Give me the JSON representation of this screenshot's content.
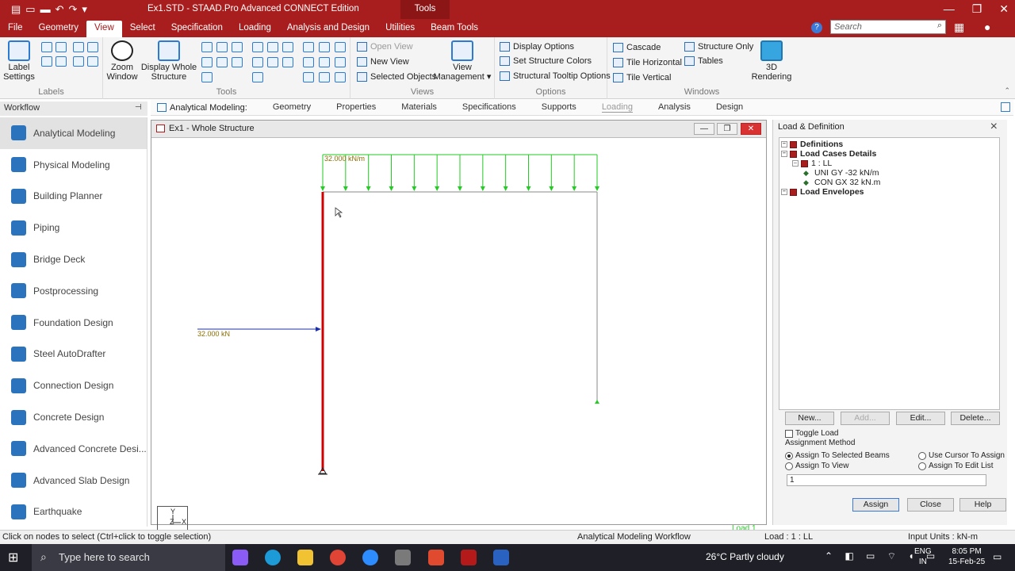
{
  "window": {
    "title": "Ex1.STD - STAAD.Pro Advanced CONNECT Edition",
    "contextual_tab_group": "Tools"
  },
  "menu_tabs": [
    "File",
    "Geometry",
    "View",
    "Select",
    "Specification",
    "Loading",
    "Analysis and Design",
    "Utilities",
    "Beam Tools"
  ],
  "active_menu_tab": "View",
  "search": {
    "placeholder": "Search"
  },
  "ribbon": {
    "labels_group": {
      "name": "Labels",
      "label_settings": "Label Settings"
    },
    "tools_group": {
      "name": "Tools",
      "zoom_window": "Zoom Window",
      "display_whole_structure": "Display Whole Structure"
    },
    "views_group": {
      "name": "Views",
      "open_view": "Open View",
      "new_view": "New View",
      "selected_objects": "Selected Objects",
      "view_management": "View Management"
    },
    "options_group": {
      "name": "Options",
      "display_options": "Display Options",
      "set_structure_colors": "Set Structure Colors",
      "structural_tooltip_options": "Structural Tooltip Options"
    },
    "windows_group": {
      "name": "Windows",
      "cascade": "Cascade",
      "tile_horizontal": "Tile Horizontal",
      "tile_vertical": "Tile Vertical",
      "structure_only": "Structure Only",
      "tables": "Tables",
      "rendering_3d": "3D Rendering"
    }
  },
  "workflow": {
    "title": "Workflow",
    "items": [
      {
        "label": "Analytical Modeling",
        "active": true
      },
      {
        "label": "Physical Modeling"
      },
      {
        "label": "Building Planner"
      },
      {
        "label": "Piping"
      },
      {
        "label": "Bridge Deck"
      },
      {
        "label": "Postprocessing"
      },
      {
        "label": "Foundation Design"
      },
      {
        "label": "Steel AutoDrafter"
      },
      {
        "label": "Connection Design"
      },
      {
        "label": "Concrete Design"
      },
      {
        "label": "Advanced Concrete Desi..."
      },
      {
        "label": "Advanced Slab Design"
      },
      {
        "label": "Earthquake"
      }
    ]
  },
  "subtabs": {
    "lead": "Analytical Modeling:",
    "items": [
      "Geometry",
      "Properties",
      "Materials",
      "Specifications",
      "Supports",
      "Loading",
      "Analysis",
      "Design"
    ],
    "active": "Loading"
  },
  "view_window": {
    "title": "Ex1 - Whole Structure",
    "udl_label": "32.000 kN/m",
    "point_load_label": "32.000 kN",
    "load_indicator": "Load 1",
    "axis": {
      "y": "Y",
      "z": "Z",
      "x": "X"
    }
  },
  "load_definition": {
    "title": "Load & Definition",
    "tree": [
      {
        "label": "Definitions",
        "level": 0,
        "bold": true
      },
      {
        "label": "Load Cases Details",
        "level": 0,
        "bold": true
      },
      {
        "label": "1 : LL",
        "level": 1
      },
      {
        "label": "UNI GY -32 kN/m",
        "level": 2
      },
      {
        "label": "CON GX 32 kN.m",
        "level": 2
      },
      {
        "label": "Load Envelopes",
        "level": 0,
        "bold": true
      }
    ],
    "buttons": {
      "new": "New...",
      "add": "Add...",
      "edit": "Edit...",
      "delete": "Delete..."
    },
    "toggle_load": "Toggle Load",
    "assignment_method": "Assignment Method",
    "options": {
      "assign_selected_beams": "Assign To Selected Beams",
      "use_cursor": "Use Cursor To Assign",
      "assign_view": "Assign To View",
      "assign_edit_list": "Assign To Edit List"
    },
    "edit_list_value": "1",
    "footer_buttons": {
      "assign": "Assign",
      "close": "Close",
      "help": "Help"
    }
  },
  "status_bar": {
    "hint": "Click on nodes to select (Ctrl+click to toggle selection)",
    "workflow": "Analytical Modeling Workflow",
    "load": "Load : 1 : LL",
    "units": "Input Units : kN-m"
  },
  "taskbar": {
    "search": "Type here to search",
    "weather": "26°C  Partly cloudy",
    "lang_1": "ENG",
    "lang_2": "IN",
    "time": "8:05 PM",
    "date": "15-Feb-25"
  },
  "colors": {
    "brand": "#a81d1d",
    "load_green": "#22cc22",
    "member_red": "#d00000",
    "point_load_blue": "#1a2fa8"
  }
}
